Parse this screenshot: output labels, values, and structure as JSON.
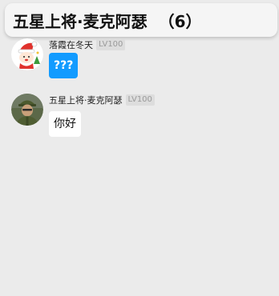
{
  "header": {
    "title": "五星上将·麦克阿瑟",
    "count": "（6）"
  },
  "messages": [
    {
      "nickname": "落霞在冬天",
      "level": "LV100",
      "text": "???",
      "avatar_icon": "christmas-cartoon-avatar-icon",
      "bubble_color": "#129bff"
    },
    {
      "nickname": "五星上将·麦克阿瑟",
      "level": "LV100",
      "text": "你好",
      "avatar_icon": "soldier-photo-avatar-icon",
      "bubble_color": "#ffffff"
    }
  ],
  "colors": {
    "background": "#ebebeb",
    "header_background": "#f5f5f5",
    "accent_bubble": "#129bff"
  }
}
